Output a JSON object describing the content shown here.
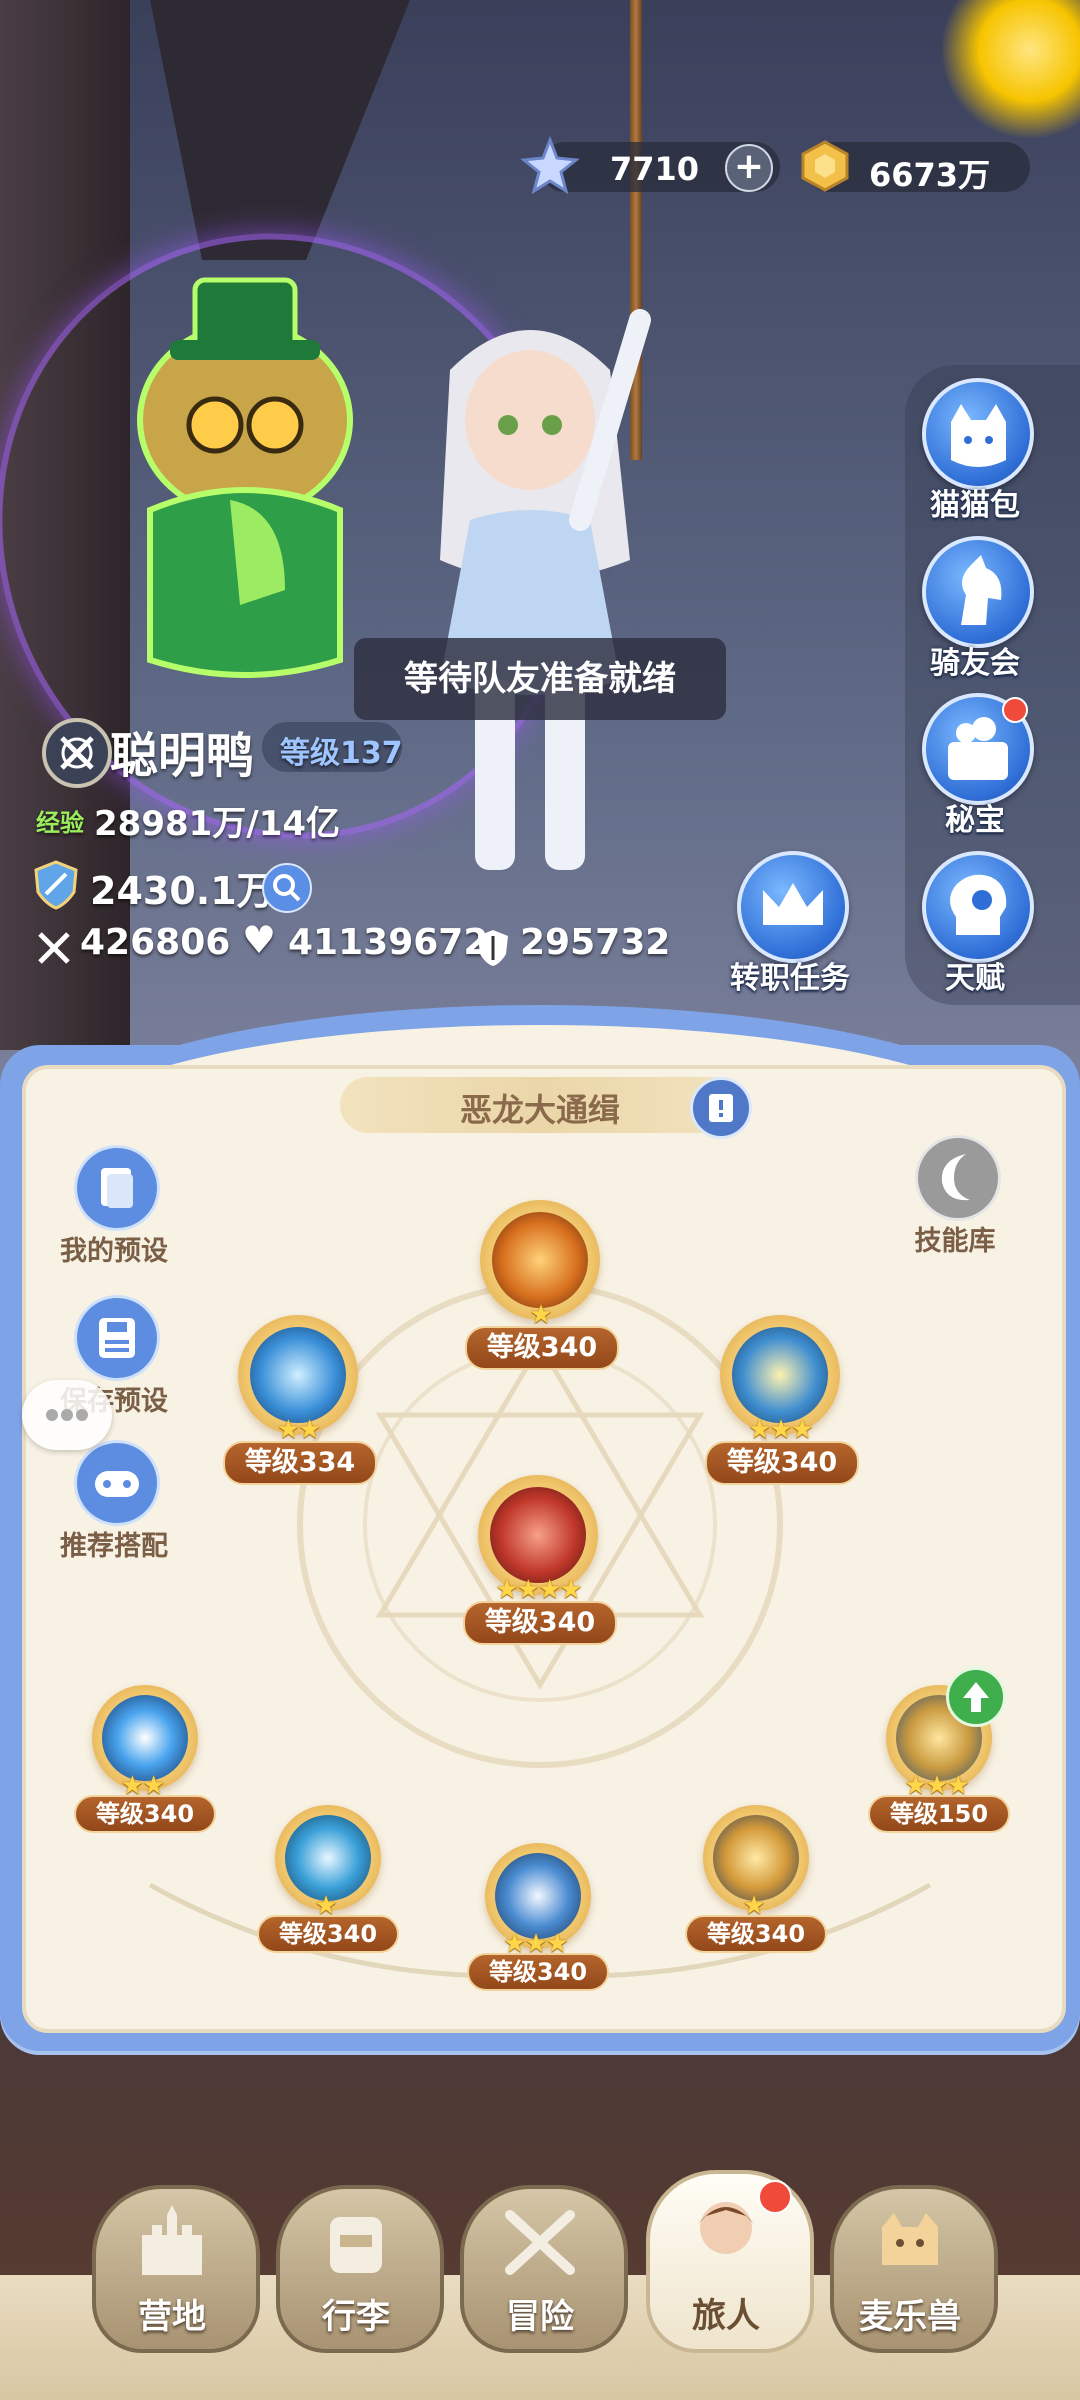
{
  "currency": {
    "diamond": "7710",
    "coin": "6673万"
  },
  "side_menu": [
    {
      "label": "猫猫包",
      "icon": "cat-bag-icon"
    },
    {
      "label": "骑友会",
      "icon": "horse-icon"
    },
    {
      "label": "秘宝",
      "icon": "treasure-icon",
      "badge": true
    },
    {
      "label": "天赋",
      "icon": "brain-icon"
    }
  ],
  "job_quest": {
    "label": "转职任务"
  },
  "status_message": "等待队友准备就绪",
  "player": {
    "name": "聪明鸭",
    "level_label": "等级137",
    "exp_label": "经验",
    "exp_value": "28981万/14亿",
    "power": "2430.1万",
    "attack": "426806",
    "hp": "41139672",
    "defense": "295732"
  },
  "panel": {
    "title": "恶龙大通缉",
    "tools": [
      "我的预设",
      "保存预设",
      "推荐搭配"
    ],
    "skill_library": "技能库",
    "skills": [
      {
        "id": "top",
        "level": "等级340",
        "stars": "★"
      },
      {
        "id": "upper-left",
        "level": "等级334",
        "stars": "★★"
      },
      {
        "id": "upper-right",
        "level": "等级340",
        "stars": "★★★"
      },
      {
        "id": "center",
        "level": "等级340",
        "stars": "★★★★"
      },
      {
        "id": "bottom-1",
        "level": "等级340",
        "stars": "★★"
      },
      {
        "id": "bottom-2",
        "level": "等级340",
        "stars": "★"
      },
      {
        "id": "bottom-3",
        "level": "等级340",
        "stars": "★★★"
      },
      {
        "id": "bottom-4",
        "level": "等级340",
        "stars": "★"
      },
      {
        "id": "bottom-5",
        "level": "等级150",
        "stars": "★★★"
      }
    ]
  },
  "nav": [
    {
      "label": "营地",
      "icon": "castle-icon"
    },
    {
      "label": "行李",
      "icon": "backpack-icon"
    },
    {
      "label": "冒险",
      "icon": "crossed-swords-icon"
    },
    {
      "label": "旅人",
      "icon": "traveler-portrait-icon",
      "active": true,
      "badge": true
    },
    {
      "label": "麦乐兽",
      "icon": "cat-pet-icon"
    }
  ],
  "colors": {
    "panel_border": "#7ea3e6",
    "panel_bg": "#f8f2e4",
    "level_badge": "#a3552a",
    "side_button": "#2f6ed6"
  }
}
